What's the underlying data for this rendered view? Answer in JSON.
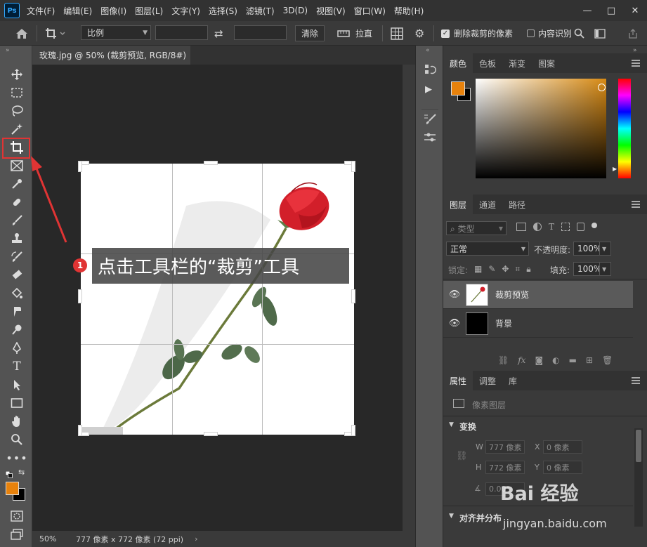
{
  "app": {
    "logo": "Ps",
    "menu": [
      "文件(F)",
      "编辑(E)",
      "图像(I)",
      "图层(L)",
      "文字(Y)",
      "选择(S)",
      "滤镜(T)",
      "3D(D)",
      "视图(V)",
      "窗口(W)",
      "帮助(H)"
    ],
    "window_controls": [
      "—",
      "□",
      "✕"
    ]
  },
  "options_bar": {
    "ratio_label": "比例",
    "clear_label": "清除",
    "straighten_label": "拉直",
    "delete_cropped_label": "删除裁剪的像素",
    "delete_cropped_checked": true,
    "content_aware_label": "内容识别",
    "content_aware_checked": false
  },
  "document": {
    "tab_title": "玫瑰.jpg @ 50% (裁剪预览, RGB/8#)",
    "zoom": "50%",
    "doc_size": "777 像素 x 772 像素 (72 ppi)"
  },
  "annotation": {
    "badge": "1",
    "text": "点击工具栏的“裁剪”工具"
  },
  "colors": {
    "foreground": "#e8820c",
    "background": "#000000",
    "highlight": "#e03434",
    "accent": "#d78a14"
  },
  "color_panel": {
    "tabs": [
      "颜色",
      "色板",
      "渐变",
      "图案"
    ]
  },
  "layers_panel": {
    "tabs": [
      "图层",
      "通道",
      "路径"
    ],
    "filter_label": "类型",
    "blend_mode": "正常",
    "opacity_label": "不透明度:",
    "opacity_value": "100%",
    "lock_label": "锁定:",
    "fill_label": "填充:",
    "fill_value": "100%",
    "layers": [
      {
        "name": "裁剪预览",
        "selected": true
      },
      {
        "name": "背景",
        "selected": false
      }
    ]
  },
  "properties_panel": {
    "tabs": [
      "属性",
      "调整",
      "库"
    ],
    "kind": "像素图层",
    "transform_title": "变换",
    "w_label": "W",
    "w_value": "777 像素",
    "x_label": "X",
    "x_value": "0 像素",
    "h_label": "H",
    "h_value": "772 像素",
    "y_label": "Y",
    "y_value": "0 像素",
    "angle_value": "0.00°",
    "align_title": "对齐并分布"
  },
  "watermark": {
    "brand": "Bai 经验",
    "url": "jingyan.baidu.com"
  }
}
